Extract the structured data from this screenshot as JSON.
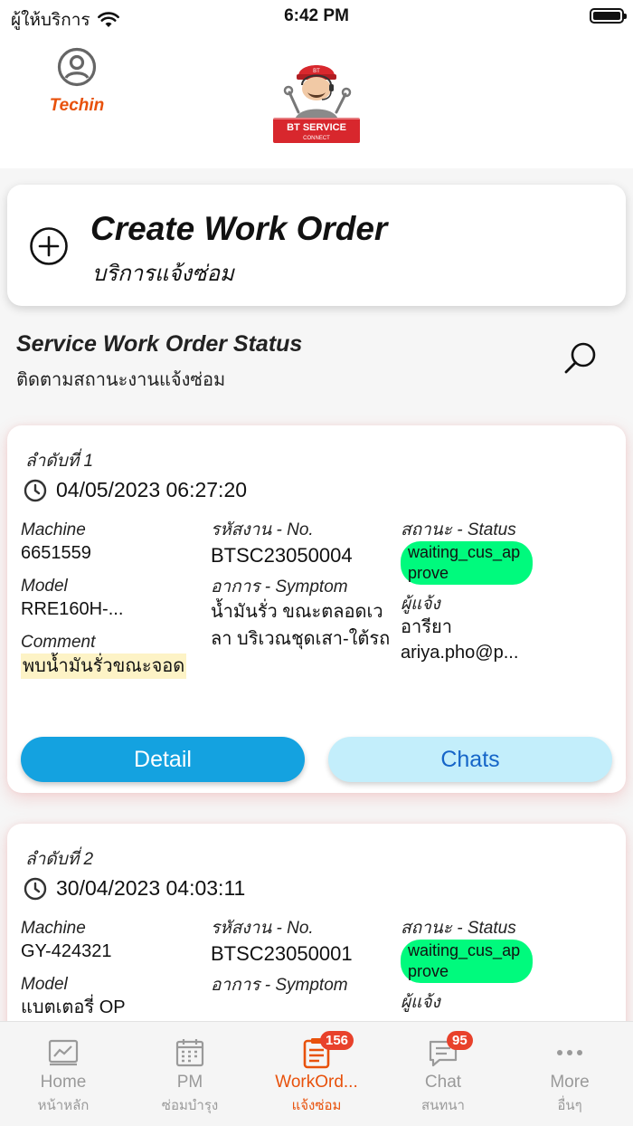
{
  "status_bar": {
    "carrier": "ผู้ให้บริการ",
    "time": "6:42 PM"
  },
  "header": {
    "profile_name": "Techin",
    "logo_text": "BT SERVICE",
    "logo_sub": "CONNECT",
    "logo_mark": "BT"
  },
  "create": {
    "title": "Create Work Order",
    "subtitle": "บริการแจ้งซ่อม"
  },
  "section": {
    "title": "Service Work Order Status",
    "subtitle": "ติดตามสถานะงานแจ้งซ่อม"
  },
  "labels": {
    "machine": "Machine",
    "model": "Model",
    "comment": "Comment",
    "no": "รหัสงาน - No.",
    "symptom": "อาการ - Symptom",
    "status": "สถานะ - Status",
    "reporter": "ผู้แจ้ง",
    "detail_button": "Detail",
    "chats_button": "Chats"
  },
  "orders": [
    {
      "seq": "ลำดับที่ 1",
      "datetime": "04/05/2023 06:27:20",
      "machine": "6651559",
      "model": "RRE160H-...",
      "comment": "พบน้ำมันรั่วขณะจอด",
      "no": "BTSC23050004",
      "symptom": "น้ำมันรั่ว ขณะตลอดเวลา บริเวณชุดเสา-ใต้รถ",
      "status": "waiting_cus_approve",
      "reporter_name": "อารียา",
      "reporter_email": "ariya.pho@p..."
    },
    {
      "seq": "ลำดับที่ 2",
      "datetime": "30/04/2023 04:03:11",
      "machine": "GY-424321",
      "model": "แบตเตอรี่ OP",
      "no": "BTSC23050001",
      "symptom": "",
      "status": "waiting_cus_approve"
    }
  ],
  "tabs": [
    {
      "label": "Home",
      "sub": "หน้าหลัก"
    },
    {
      "label": "PM",
      "sub": "ซ่อมบำรุง"
    },
    {
      "label": "WorkOrd...",
      "sub": "แจ้งซ่อม",
      "badge": "156"
    },
    {
      "label": "Chat",
      "sub": "สนทนา",
      "badge": "95"
    },
    {
      "label": "More",
      "sub": "อื่นๆ"
    }
  ],
  "colors": {
    "accent": "#e8510b",
    "status_green": "#00fa7d",
    "detail_blue": "#14a2e0",
    "chats_bg": "#c3eefb",
    "badge_red": "#e8412b"
  }
}
